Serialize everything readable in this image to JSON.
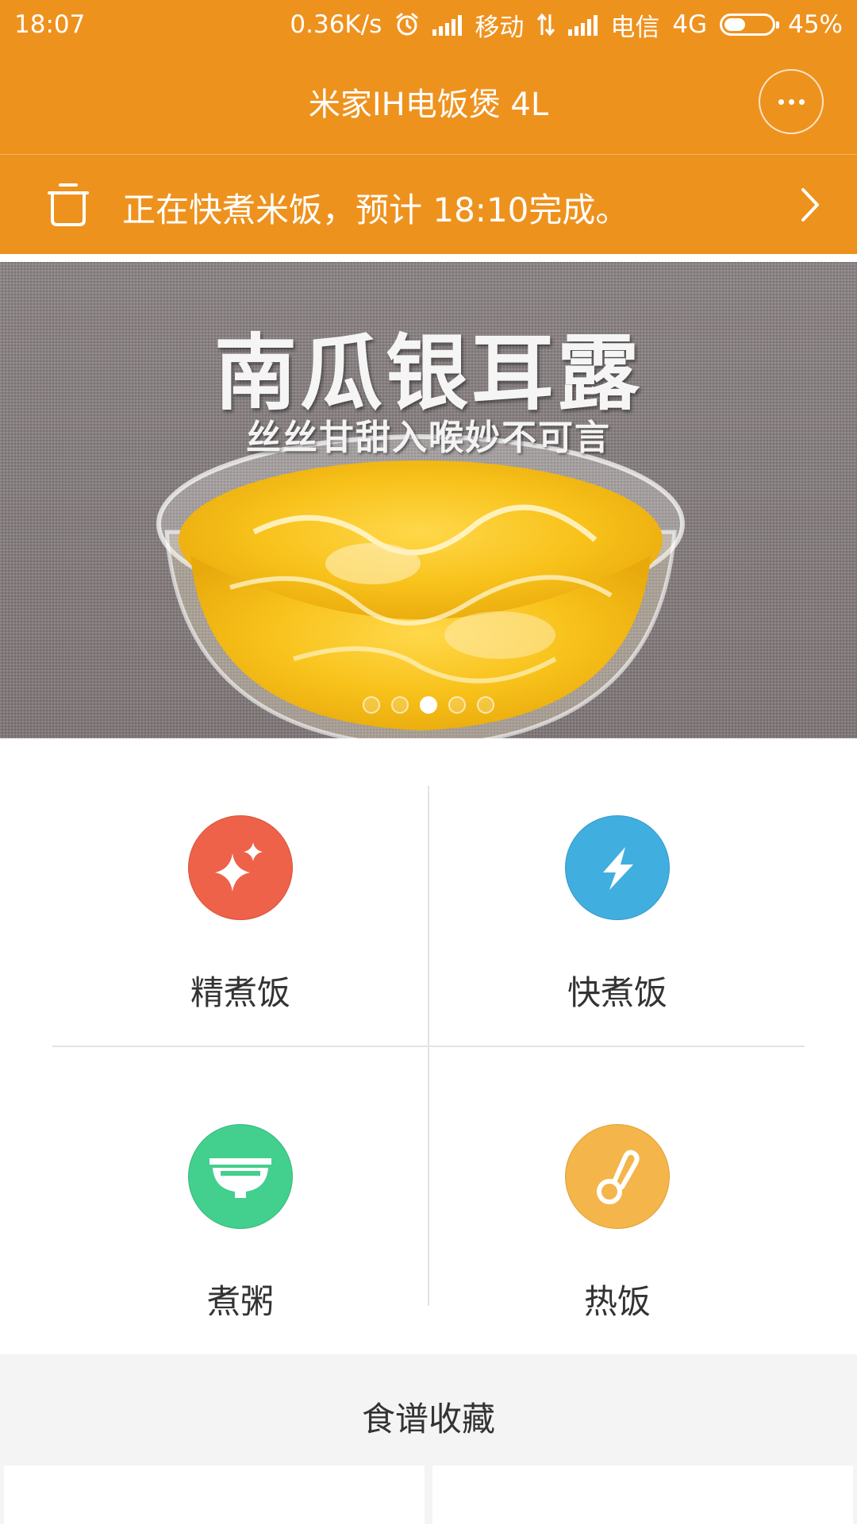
{
  "status_bar": {
    "time": "18:07",
    "net_speed": "0.36K/s",
    "carrier1": "移动",
    "carrier2": "电信",
    "network_type": "4G",
    "battery": "45%",
    "battery_level": 0.45,
    "icons": [
      "alarm-icon",
      "signal-icon",
      "data-arrows-icon",
      "battery-icon"
    ]
  },
  "header": {
    "title": "米家IH电饭煲 4L",
    "more_icon": "more-dots-icon"
  },
  "notice": {
    "text": "正在快煮米饭，预计 18:10完成。",
    "icon": "pot-icon",
    "chevron": "chevron-right-icon"
  },
  "banner": {
    "title": "南瓜银耳露",
    "subtitle": "丝丝甘甜入喉妙不可言",
    "slide_count": 5,
    "active_slide": 3
  },
  "modes": [
    {
      "label": "精煮饭",
      "icon": "sparkle-icon",
      "color": "#ee624a"
    },
    {
      "label": "快煮饭",
      "icon": "lightning-icon",
      "color": "#41aee0"
    },
    {
      "label": "煮粥",
      "icon": "bowl-icon",
      "color": "#43cf8d"
    },
    {
      "label": "热饭",
      "icon": "thermometer-icon",
      "color": "#f4b54a"
    }
  ],
  "favorites": {
    "title": "食谱收藏"
  },
  "colors": {
    "brand_orange": "#ee921e",
    "divider": "#e3e3e3",
    "section_bg": "#f4f4f4"
  }
}
